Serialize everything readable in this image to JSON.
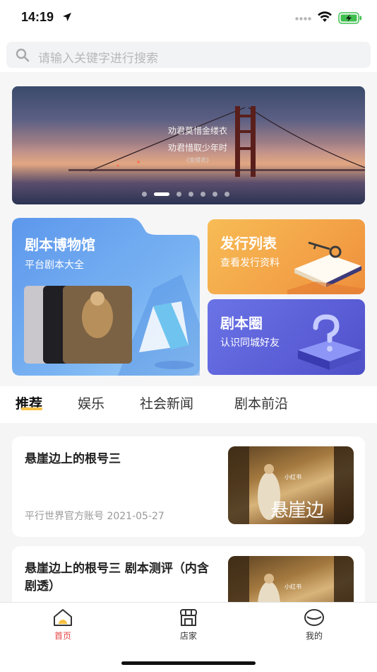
{
  "status_bar": {
    "time": "14:19",
    "icons": [
      "location-arrow-icon",
      "signal-dots-icon",
      "wifi-icon",
      "battery-charging-icon"
    ]
  },
  "search": {
    "placeholder": "请输入关键字进行搜索",
    "icon": "search-icon"
  },
  "banner": {
    "line1": "劝君莫惜金缕衣",
    "line2": "劝君惜取少年时",
    "line3": "《金缕衣》",
    "slide_count": 7,
    "active_slide": 2
  },
  "cards": {
    "museum": {
      "title": "剧本博物馆",
      "subtitle": "平台剧本大全"
    },
    "release": {
      "title": "发行列表",
      "subtitle": "查看发行资料"
    },
    "circle": {
      "title": "剧本圈",
      "subtitle": "认识同城好友"
    }
  },
  "tabs": [
    {
      "label": "推荐",
      "active": true
    },
    {
      "label": "娱乐",
      "active": false
    },
    {
      "label": "社会新闻",
      "active": false
    },
    {
      "label": "剧本前沿",
      "active": false
    }
  ],
  "articles": [
    {
      "title": "悬崖边上的根号三",
      "author": "平行世界官方账号",
      "date": "2021-05-27",
      "thumb_brand": "小红书",
      "thumb_calligraphy": "悬崖边"
    },
    {
      "title": "悬崖边上的根号三 剧本测评（内含剧透）",
      "thumb_brand": "小红书"
    }
  ],
  "bottom_nav": [
    {
      "label": "首页",
      "icon": "home-icon",
      "active": true
    },
    {
      "label": "店家",
      "icon": "store-icon",
      "active": false
    },
    {
      "label": "我的",
      "icon": "profile-icon",
      "active": false
    }
  ],
  "colors": {
    "accent_yellow": "#f7c244",
    "nav_active": "#e64545",
    "museum_blue": "#6aa7ee",
    "release_orange": "#f3a247",
    "circle_purple": "#5b5ed6"
  }
}
